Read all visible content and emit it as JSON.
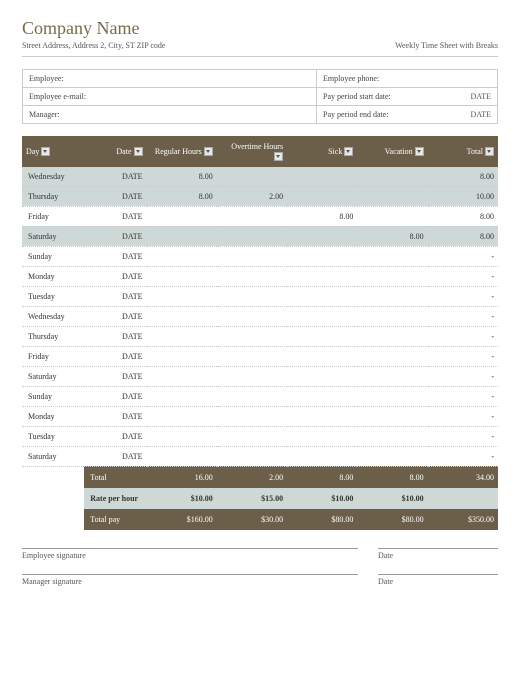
{
  "header": {
    "company": "Company Name",
    "address": "Street Address, Address 2, City, ST ZIP code",
    "doc_title": "Weekly Time Sheet with Breaks"
  },
  "info": {
    "employee_label": "Employee:",
    "email_label": "Employee e-mail:",
    "manager_label": "Manager:",
    "phone_label": "Employee phone:",
    "start_label": "Pay period start date:",
    "end_label": "Pay period end date:",
    "start_val": "DATE",
    "end_val": "DATE"
  },
  "columns": [
    "Day",
    "Date",
    "Regular Hours",
    "Overtime Hours",
    "Sick",
    "Vacation",
    "Total"
  ],
  "rows": [
    {
      "day": "Wednesday",
      "date": "DATE",
      "reg": "8.00",
      "ot": "",
      "sick": "",
      "vac": "",
      "total": "8.00",
      "alt": true
    },
    {
      "day": "Thursday",
      "date": "DATE",
      "reg": "8.00",
      "ot": "2.00",
      "sick": "",
      "vac": "",
      "total": "10.00",
      "alt": true
    },
    {
      "day": "Friday",
      "date": "DATE",
      "reg": "",
      "ot": "",
      "sick": "8.00",
      "vac": "",
      "total": "8.00",
      "alt": false
    },
    {
      "day": "Saturday",
      "date": "DATE",
      "reg": "",
      "ot": "",
      "sick": "",
      "vac": "8.00",
      "total": "8.00",
      "alt": true
    },
    {
      "day": "Sunday",
      "date": "DATE",
      "reg": "",
      "ot": "",
      "sick": "",
      "vac": "",
      "total": "-",
      "alt": false
    },
    {
      "day": "Monday",
      "date": "DATE",
      "reg": "",
      "ot": "",
      "sick": "",
      "vac": "",
      "total": "-",
      "alt": false
    },
    {
      "day": "Tuesday",
      "date": "DATE",
      "reg": "",
      "ot": "",
      "sick": "",
      "vac": "",
      "total": "-",
      "alt": false
    },
    {
      "day": "Wednesday",
      "date": "DATE",
      "reg": "",
      "ot": "",
      "sick": "",
      "vac": "",
      "total": "-",
      "alt": false
    },
    {
      "day": "Thursday",
      "date": "DATE",
      "reg": "",
      "ot": "",
      "sick": "",
      "vac": "",
      "total": "-",
      "alt": false
    },
    {
      "day": "Friday",
      "date": "DATE",
      "reg": "",
      "ot": "",
      "sick": "",
      "vac": "",
      "total": "-",
      "alt": false
    },
    {
      "day": "Saturday",
      "date": "DATE",
      "reg": "",
      "ot": "",
      "sick": "",
      "vac": "",
      "total": "-",
      "alt": false
    },
    {
      "day": "Sunday",
      "date": "DATE",
      "reg": "",
      "ot": "",
      "sick": "",
      "vac": "",
      "total": "-",
      "alt": false
    },
    {
      "day": "Monday",
      "date": "DATE",
      "reg": "",
      "ot": "",
      "sick": "",
      "vac": "",
      "total": "-",
      "alt": false
    },
    {
      "day": "Tuesday",
      "date": "DATE",
      "reg": "",
      "ot": "",
      "sick": "",
      "vac": "",
      "total": "-",
      "alt": false
    },
    {
      "day": "Saturday",
      "date": "DATE",
      "reg": "",
      "ot": "",
      "sick": "",
      "vac": "",
      "total": "-",
      "alt": false
    }
  ],
  "totals": {
    "label": "Total",
    "reg": "16.00",
    "ot": "2.00",
    "sick": "8.00",
    "vac": "8.00",
    "total": "34.00"
  },
  "rate": {
    "label": "Rate per hour",
    "reg": "$10.00",
    "ot": "$15.00",
    "sick": "$10.00",
    "vac": "$10.00",
    "total": ""
  },
  "pay": {
    "label": "Total pay",
    "reg": "$160.00",
    "ot": "$30.00",
    "sick": "$80.00",
    "vac": "$80.00",
    "total": "$350.00"
  },
  "sig": {
    "emp": "Employee signature",
    "mgr": "Manager signature",
    "date": "Date"
  }
}
